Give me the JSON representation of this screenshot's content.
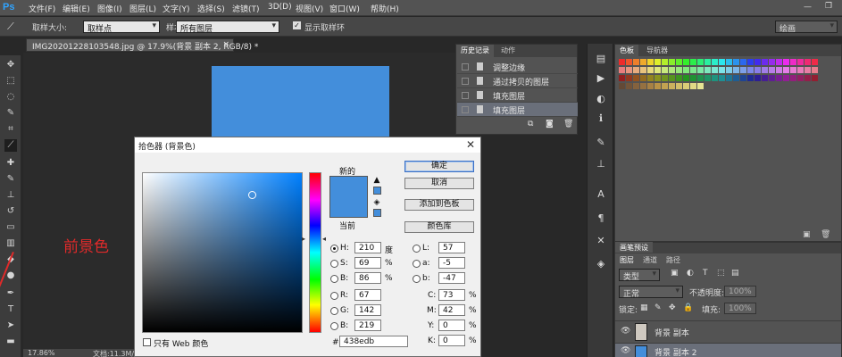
{
  "app": {
    "logo": "Ps"
  },
  "menu": [
    "文件(F)",
    "编辑(E)",
    "图像(I)",
    "图层(L)",
    "文字(Y)",
    "选择(S)",
    "滤镜(T)",
    "3D(D)",
    "视图(V)",
    "窗口(W)",
    "帮助(H)"
  ],
  "options": {
    "sample_size_label": "取样大小:",
    "sample_size_value": "取样点",
    "sample_label": "样本:",
    "sample_value": "所有图层",
    "show_ring_label": "显示取样环",
    "workspace": "绘画"
  },
  "document": {
    "tab_title": "IMG20201228103548.jpg @ 17.9%(背景 副本 2, RGB/8) *",
    "zoom": "17.86%",
    "doc_info": "文档:11.3M/8",
    "canvas_color": "#438edb"
  },
  "history": {
    "tabs": [
      "历史记录",
      "动作"
    ],
    "items": [
      "调整边缘",
      "通过拷贝的图层",
      "填充图层",
      "填充图层"
    ]
  },
  "swatches": {
    "tabs": [
      "色板",
      "导航器"
    ]
  },
  "layers": {
    "top_tab": "画笔预设",
    "tabs": [
      "图层",
      "通道",
      "路径"
    ],
    "kind": "类型",
    "blend_mode": "正常",
    "opacity_label": "不透明度:",
    "opacity_value": "100%",
    "lock_label": "锁定:",
    "fill_label": "填充:",
    "fill_value": "100%",
    "items": [
      "背景 副本",
      "背景 副本 2"
    ]
  },
  "dialog": {
    "title": "拾色器 (背景色)",
    "new_label": "新的",
    "current_label": "当前",
    "buttons": {
      "ok": "确定",
      "cancel": "取消",
      "add_swatch": "添加到色板",
      "color_libraries": "颜色库"
    },
    "web_only": "只有 Web 颜色",
    "fields": {
      "H": {
        "label": "H:",
        "value": "210",
        "unit": "度"
      },
      "S": {
        "label": "S:",
        "value": "69",
        "unit": "%"
      },
      "B": {
        "label": "B:",
        "value": "86",
        "unit": "%"
      },
      "R": {
        "label": "R:",
        "value": "67"
      },
      "G": {
        "label": "G:",
        "value": "142"
      },
      "Bv": {
        "label": "B:",
        "value": "219"
      },
      "L": {
        "label": "L:",
        "value": "57"
      },
      "a": {
        "label": "a:",
        "value": "-5"
      },
      "b": {
        "label": "b:",
        "value": "-47"
      },
      "C": {
        "label": "C:",
        "value": "73",
        "unit": "%"
      },
      "M": {
        "label": "M:",
        "value": "42",
        "unit": "%"
      },
      "Y": {
        "label": "Y:",
        "value": "0",
        "unit": "%"
      },
      "K": {
        "label": "K:",
        "value": "0",
        "unit": "%"
      }
    },
    "hex_label": "#",
    "hex_value": "438edb",
    "color": "#438edb"
  },
  "annotation": "前景色"
}
